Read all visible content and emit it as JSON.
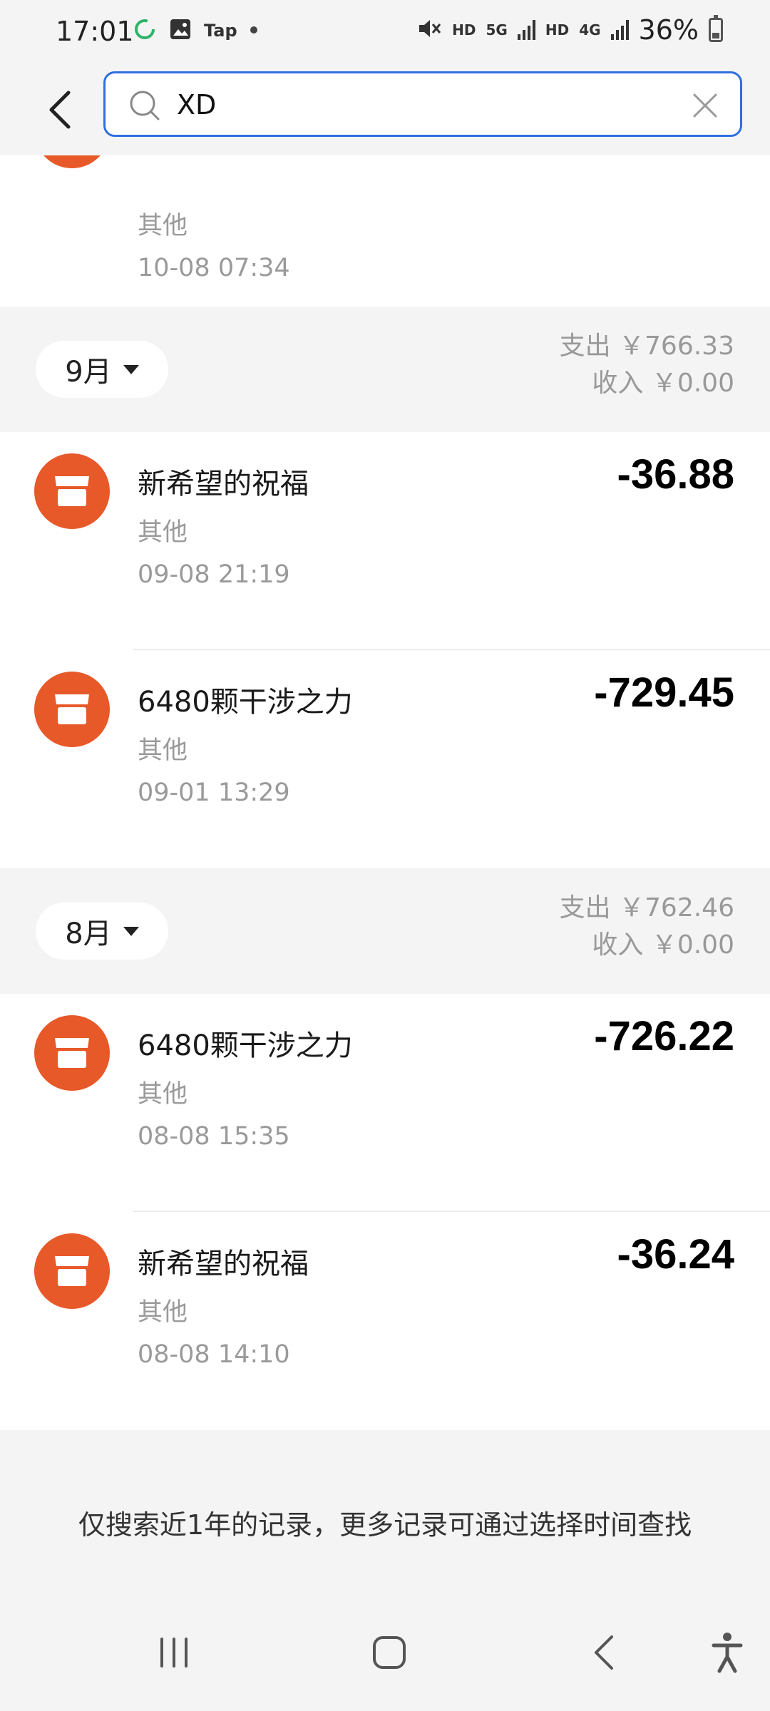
{
  "status_bar": {
    "time": "17:01",
    "app_label": "Tap",
    "hd1": "HD",
    "net1": "5G",
    "hd2": "HD",
    "net2": "4G",
    "battery": "36%"
  },
  "search": {
    "value": "XD"
  },
  "partial_item": {
    "category": "其他",
    "time": "10-08 07:34"
  },
  "months": [
    {
      "label": "9月",
      "expense": "支出 ￥766.33",
      "income": "收入 ￥0.00",
      "items": [
        {
          "title": "新希望的祝福",
          "category": "其他",
          "time": "09-08 21:19",
          "amount": "-36.88"
        },
        {
          "title": "6480颗干涉之力",
          "category": "其他",
          "time": "09-01 13:29",
          "amount": "-729.45"
        }
      ]
    },
    {
      "label": "8月",
      "expense": "支出 ￥762.46",
      "income": "收入 ￥0.00",
      "items": [
        {
          "title": "6480颗干涉之力",
          "category": "其他",
          "time": "08-08 15:35",
          "amount": "-726.22"
        },
        {
          "title": "新希望的祝福",
          "category": "其他",
          "time": "08-08 14:10",
          "amount": "-36.24"
        }
      ]
    }
  ],
  "footer_note": "仅搜索近1年的记录，更多记录可通过选择时间查找",
  "colors": {
    "accent": "#2f6fe0",
    "merchant_icon": "#e8592a",
    "background": "#f4f4f4"
  }
}
